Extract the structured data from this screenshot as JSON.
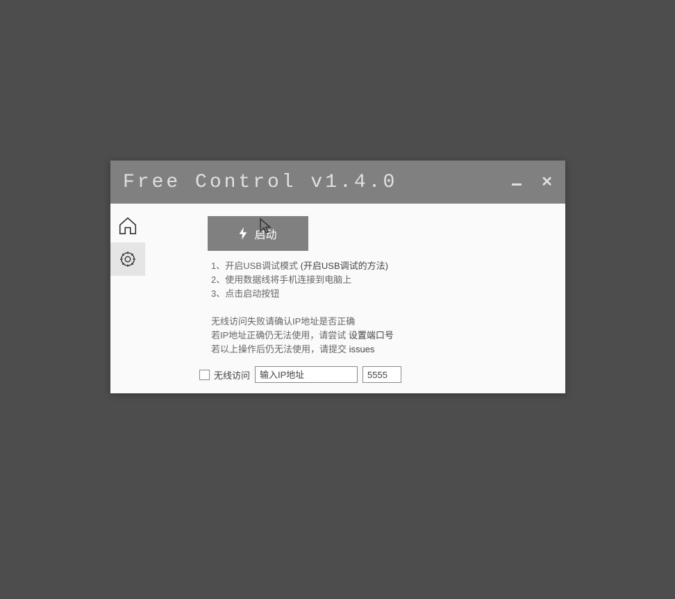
{
  "window": {
    "title": "Free Control v1.4.0"
  },
  "start_button": {
    "label": "启动"
  },
  "instructions": {
    "line1_prefix": "1、开启USB调试模式 ",
    "line1_link": "(开启USB调试的方法)",
    "line2": "2、使用数据线将手机连接到电脑上",
    "line3": "3、点击启动按钮"
  },
  "info": {
    "line1": "无线访问失败请确认IP地址是否正确",
    "line2_prefix": "若IP地址正确仍无法使用，请尝试 ",
    "line2_link": "设置端口号",
    "line3_prefix": "若以上操作后仍无法使用，请提交 ",
    "line3_link": "issues"
  },
  "form": {
    "wireless_label": "无线访问",
    "ip_placeholder": "输入IP地址",
    "port_value": "5555"
  }
}
